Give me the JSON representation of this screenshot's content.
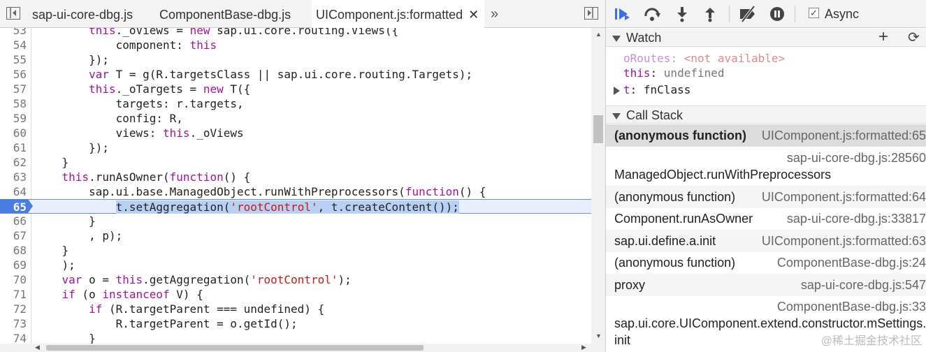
{
  "tabs": [
    {
      "label": "sap-ui-core-dbg.js"
    },
    {
      "label": "ComponentBase-dbg.js"
    },
    {
      "label": "UIComponent.js:formatted",
      "active": true
    }
  ],
  "more_tabs": "»",
  "code": {
    "lines": [
      {
        "n": "53",
        "t": "        this._oViews = new sap.ui.core.routing.Views({"
      },
      {
        "n": "54",
        "t": "            component: this"
      },
      {
        "n": "55",
        "t": "        });"
      },
      {
        "n": "56",
        "t": "        var T = g(R.targetsClass || sap.ui.core.routing.Targets);"
      },
      {
        "n": "57",
        "t": "        this._oTargets = new T({"
      },
      {
        "n": "58",
        "t": "            targets: r.targets,"
      },
      {
        "n": "59",
        "t": "            config: R,"
      },
      {
        "n": "60",
        "t": "            views: this._oViews"
      },
      {
        "n": "61",
        "t": "        });"
      },
      {
        "n": "62",
        "t": "    }"
      },
      {
        "n": "63",
        "t": "    this.runAsOwner(function() {"
      },
      {
        "n": "64",
        "t": "        sap.ui.base.ManagedObject.runWithPreprocessors(function() {"
      },
      {
        "n": "65",
        "t": "            t.setAggregation('rootControl', t.createContent());",
        "current": true
      },
      {
        "n": "66",
        "t": "        }"
      },
      {
        "n": "67",
        "t": "        , p);"
      },
      {
        "n": "68",
        "t": "    }"
      },
      {
        "n": "69",
        "t": "    );"
      },
      {
        "n": "70",
        "t": "    var o = this.getAggregation('rootControl');"
      },
      {
        "n": "71",
        "t": "    if (o instanceof V) {"
      },
      {
        "n": "72",
        "t": "        if (R.targetParent === undefined) {"
      },
      {
        "n": "73",
        "t": "            R.targetParent = o.getId();"
      },
      {
        "n": "74",
        "t": "        }"
      }
    ]
  },
  "toolbar": {
    "async_label": "Async",
    "async_checked": "✓"
  },
  "watch": {
    "title": "Watch",
    "add_glyph": "+",
    "refresh_glyph": "⟳",
    "items": [
      {
        "name": "oRoutes",
        "sep": ": ",
        "value": "<not available>"
      },
      {
        "name": "this",
        "sep": ": ",
        "value": "undefined"
      },
      {
        "name": "t",
        "sep": ": ",
        "value": "fnClass"
      }
    ]
  },
  "callstack": {
    "title": "Call Stack",
    "frames": [
      {
        "name": "(anonymous function)",
        "loc": "UIComponent.js:formatted:65"
      },
      {
        "name": "ManagedObject.runWithPreprocessors",
        "loc": "sap-ui-core-dbg.js:28560"
      },
      {
        "name": "(anonymous function)",
        "loc": "UIComponent.js:formatted:64"
      },
      {
        "name": "Component.runAsOwner",
        "loc": "sap-ui-core-dbg.js:33817"
      },
      {
        "name": "sap.ui.define.a.init",
        "loc": "UIComponent.js:formatted:63"
      },
      {
        "name": "(anonymous function)",
        "loc": "ComponentBase-dbg.js:24"
      },
      {
        "name": "proxy",
        "loc": "sap-ui-core-dbg.js:547"
      },
      {
        "name": "sap.ui.core.UIComponent.extend.constructor.mSettings.",
        "name2": "init",
        "loc": "ComponentBase-dbg.js:33"
      }
    ]
  },
  "watermark": "@稀土掘金技术社区"
}
